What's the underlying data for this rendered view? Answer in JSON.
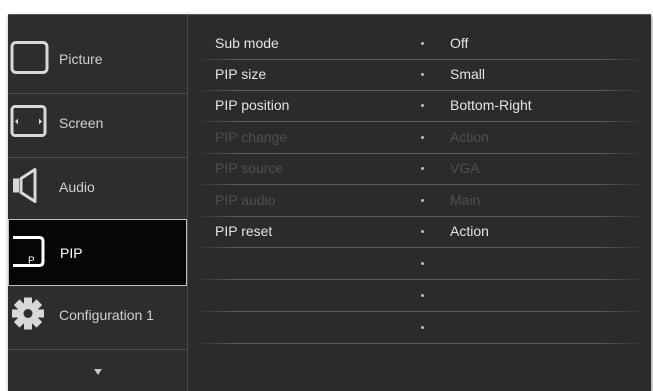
{
  "sidebar": {
    "items": [
      {
        "label": "Picture",
        "icon": "picture-icon"
      },
      {
        "label": "Screen",
        "icon": "screen-icon"
      },
      {
        "label": "Audio",
        "icon": "audio-icon"
      },
      {
        "label": "PIP",
        "icon": "pip-icon",
        "icon_text": "P"
      },
      {
        "label": "Configuration 1",
        "icon": "gear-icon"
      }
    ],
    "more_icon": "chevron-down-icon"
  },
  "menu": {
    "rows": [
      {
        "name": "Sub mode",
        "value": "Off",
        "enabled": true
      },
      {
        "name": "PIP size",
        "value": "Small",
        "enabled": true
      },
      {
        "name": "PIP position",
        "value": "Bottom-Right",
        "enabled": true
      },
      {
        "name": "PIP change",
        "value": "Action",
        "enabled": false
      },
      {
        "name": "PIP source",
        "value": "VGA",
        "enabled": false
      },
      {
        "name": "PIP audio",
        "value": "Main",
        "enabled": false
      },
      {
        "name": "PIP reset",
        "value": "Action",
        "enabled": true
      },
      {
        "name": "",
        "value": "",
        "enabled": true
      },
      {
        "name": "",
        "value": "",
        "enabled": true
      },
      {
        "name": "",
        "value": "",
        "enabled": true
      }
    ]
  },
  "colors": {
    "background": "#2b2b2b",
    "active_item": "#060606",
    "text": "#e4e4e4",
    "disabled_text": "#4f4f4f"
  }
}
